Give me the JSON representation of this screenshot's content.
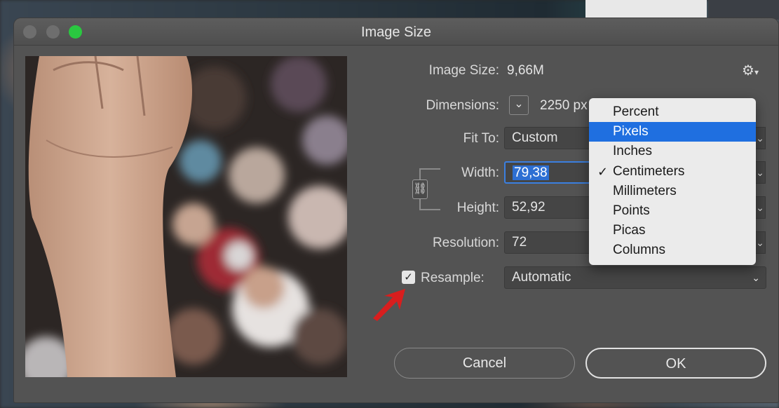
{
  "window": {
    "title": "Image Size"
  },
  "info": {
    "image_size_label": "Image Size:",
    "image_size_value": "9,66M",
    "dimensions_label": "Dimensions:",
    "dimensions_value": "2250 px"
  },
  "fit_to": {
    "label": "Fit To:",
    "value": "Custom"
  },
  "width": {
    "label": "Width:",
    "value": "79,38"
  },
  "height": {
    "label": "Height:",
    "value": "52,92"
  },
  "resolution": {
    "label": "Resolution:",
    "value": "72"
  },
  "resample": {
    "label": "Resample:",
    "checked": true,
    "value": "Automatic"
  },
  "buttons": {
    "cancel": "Cancel",
    "ok": "OK"
  },
  "unit_menu": {
    "items": [
      "Percent",
      "Pixels",
      "Inches",
      "Centimeters",
      "Millimeters",
      "Points",
      "Picas",
      "Columns"
    ],
    "highlighted": "Pixels",
    "checked": "Centimeters"
  },
  "colors": {
    "dialog_bg": "#535353",
    "menu_highlight": "#1f6fe0",
    "annotation_arrow": "#d81e1e",
    "zoom_button": "#2ac840"
  }
}
